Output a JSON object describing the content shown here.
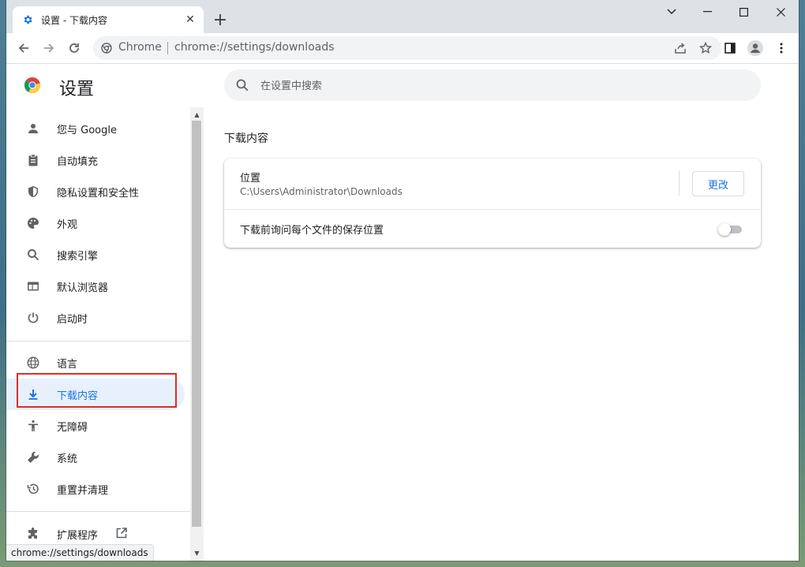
{
  "tab": {
    "title": "设置 - 下载内容",
    "close": "✕",
    "new_tab": "+"
  },
  "window_controls": {
    "minimize": "—",
    "maximize": "☐",
    "close": "✕",
    "tab_search": "⌄"
  },
  "omnibox": {
    "chip": "Chrome",
    "url": "chrome://settings/downloads"
  },
  "settings": {
    "title": "设置",
    "search_placeholder": "在设置中搜索"
  },
  "sidebar": {
    "items": [
      {
        "label": "您与 Google",
        "icon": "person-icon"
      },
      {
        "label": "自动填充",
        "icon": "clipboard-icon"
      },
      {
        "label": "隐私设置和安全性",
        "icon": "shield-icon"
      },
      {
        "label": "外观",
        "icon": "palette-icon"
      },
      {
        "label": "搜索引擎",
        "icon": "search-icon"
      },
      {
        "label": "默认浏览器",
        "icon": "browser-icon"
      },
      {
        "label": "启动时",
        "icon": "power-icon"
      },
      {
        "label": "语言",
        "icon": "globe-icon"
      },
      {
        "label": "下载内容",
        "icon": "download-icon",
        "selected": true
      },
      {
        "label": "无障碍",
        "icon": "accessibility-icon"
      },
      {
        "label": "系统",
        "icon": "wrench-icon"
      },
      {
        "label": "重置并清理",
        "icon": "history-icon"
      },
      {
        "label": "扩展程序",
        "icon": "puzzle-icon"
      }
    ]
  },
  "downloads": {
    "section_title": "下载内容",
    "location_label": "位置",
    "location_path": "C:\\Users\\Administrator\\Downloads",
    "change_button": "更改",
    "ask_label": "下载前询问每个文件的保存位置",
    "ask_enabled": false
  },
  "status_bubble": "chrome://settings/downloads",
  "colors": {
    "accent": "#1a73e8",
    "highlight_box": "#d93025",
    "selected_bg": "#e8f0fe"
  }
}
